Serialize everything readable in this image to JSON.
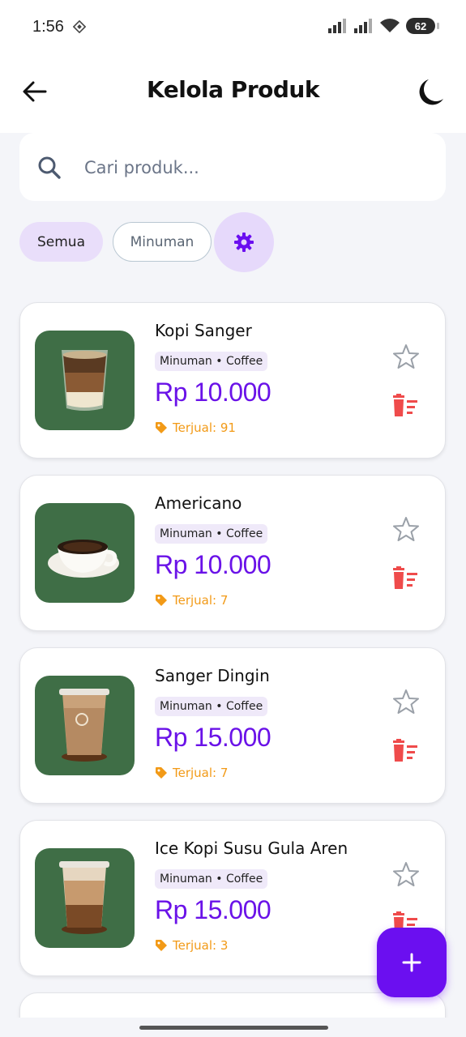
{
  "status": {
    "time": "1:56",
    "battery": "62"
  },
  "header": {
    "title": "Kelola Produk"
  },
  "search": {
    "placeholder": "Cari produk..."
  },
  "filters": {
    "all": "Semua",
    "drink": "Minuman"
  },
  "products": [
    {
      "name": "Kopi Sanger",
      "tag": "Minuman • Coffee",
      "price": "Rp 10.000",
      "sold": "Terjual: 91"
    },
    {
      "name": "Americano",
      "tag": "Minuman • Coffee",
      "price": "Rp 10.000",
      "sold": "Terjual: 7"
    },
    {
      "name": "Sanger Dingin",
      "tag": "Minuman • Coffee",
      "price": "Rp 15.000",
      "sold": "Terjual: 7"
    },
    {
      "name": "Ice Kopi Susu Gula Aren",
      "tag": "Minuman • Coffee",
      "price": "Rp 15.000",
      "sold": "Terjual: 3"
    }
  ],
  "fab": {
    "label": "+"
  },
  "colors": {
    "accent": "#6b0ff0",
    "price": "#6a12e8",
    "delete": "#ef4b4b",
    "sold": "#f29a17",
    "thumb_bg": "#3f6e46"
  },
  "icons": [
    "back-arrow-icon",
    "moon-icon",
    "search-icon",
    "gear-icon",
    "star-icon",
    "delete-list-icon",
    "tag-icon",
    "plus-icon"
  ]
}
